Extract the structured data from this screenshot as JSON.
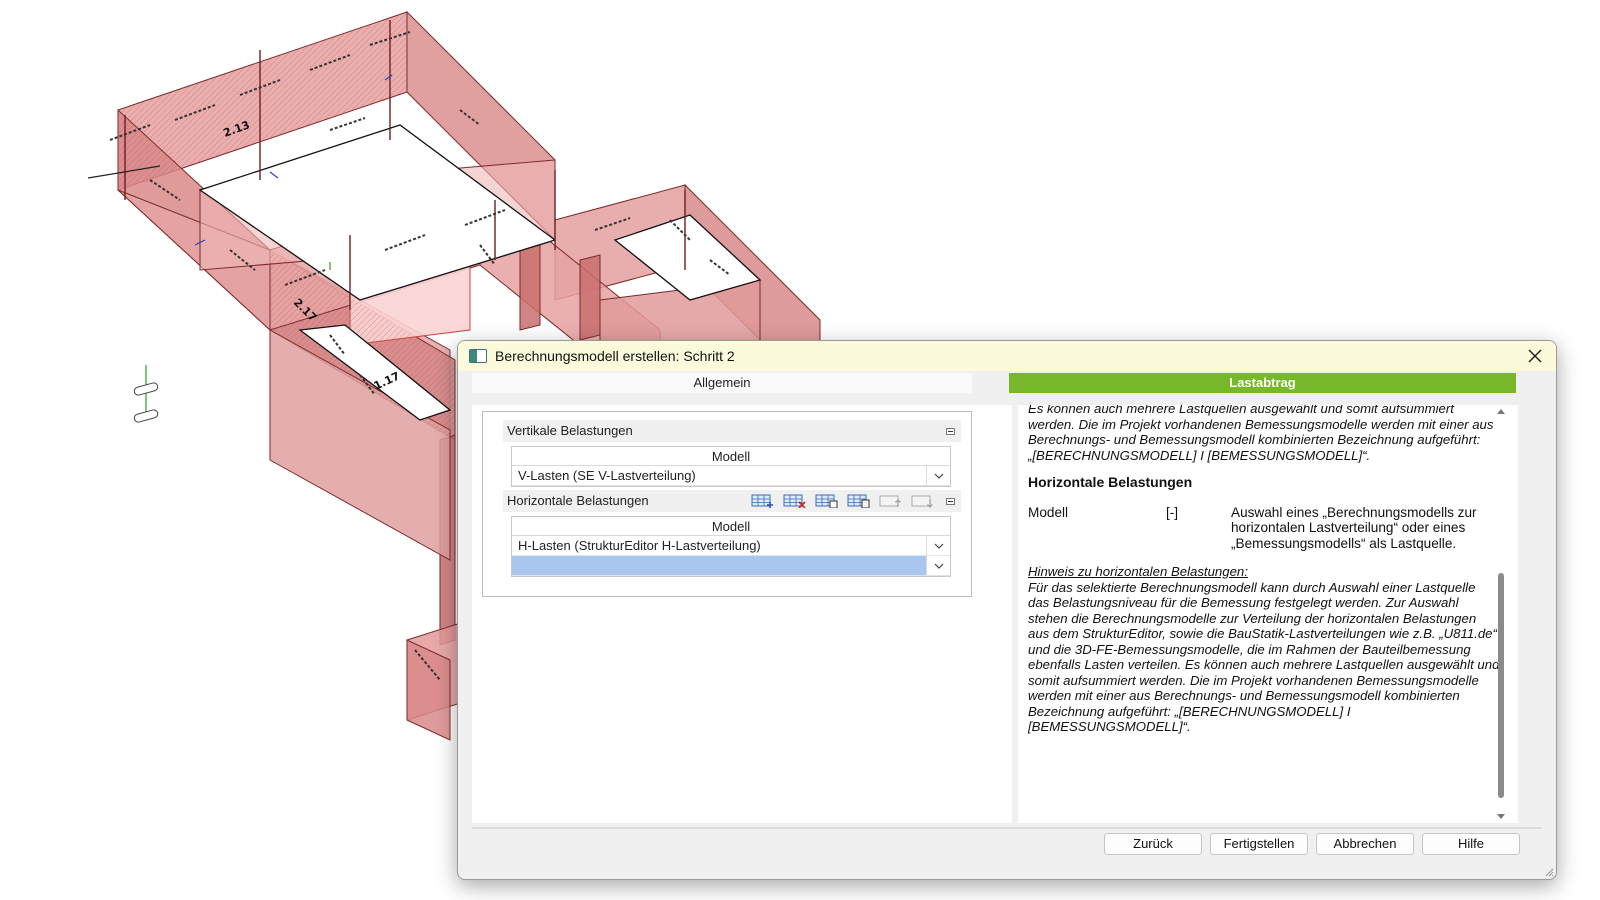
{
  "dialog": {
    "title": "Berechnungsmodell erstellen: Schritt 2",
    "tabs": [
      {
        "label": "Allgemein",
        "active": false
      },
      {
        "label": "Lastabtrag",
        "active": true
      }
    ],
    "accent_color": "#76b82a"
  },
  "vertical": {
    "section_label": "Vertikale Belastungen",
    "column_header": "Modell",
    "rows": [
      "V-Lasten (SE V-Lastverteilung)"
    ]
  },
  "horizontal": {
    "section_label": "Horizontale Belastungen",
    "column_header": "Modell",
    "rows": [
      "H-Lasten (StrukturEditor H-Lastverteilung)",
      ""
    ],
    "toolbar_icons": [
      "add-row-icon",
      "delete-row-icon",
      "copy-row-icon",
      "paste-row-icon",
      "move-up-icon",
      "move-down-icon"
    ]
  },
  "help": {
    "intro": "Es können auch mehrere Lastquellen ausgewählt und somit aufsummiert werden. Die im Projekt vorhandenen Bemessungsmodelle werden mit einer aus Berechnungs- und Bemessungsmodell kombinierten Bezeichnung aufgeführt: „[BERECHNUNGSMODELL] I [BEMESSUNGSMODELL]“.",
    "heading": "Horizontale Belastungen",
    "param_name": "Modell",
    "param_unit": "[-]",
    "param_desc": "Auswahl eines „Berechnungsmodells zur horizontalen Lastverteilung“ oder eines „Bemessungsmodells“ als Lastquelle.",
    "hint_title": "Hinweis zu horizontalen Belastungen:",
    "hint_text": "Für das selektierte Berechnungsmodell kann durch Auswahl einer Lastquelle das Belastungsniveau für die Bemessung festgelegt werden. Zur Auswahl stehen die Berechnungsmodelle zur Verteilung der horizontalen Belastungen aus dem StrukturEditor, sowie die BauStatik-Lastverteilungen wie z.B. „U811.de“ und die 3D-FE-Bemessungsmodelle, die im Rahmen der Bauteilbemessung ebenfalls Lasten verteilen. Es können auch mehrere Lastquellen ausgewählt und somit aufsummiert werden. Die im Projekt vorhandenen Bemessungsmodelle werden mit einer aus Berechnungs- und Bemessungsmodell kombinierten Bezeichnung aufgeführt: „[BERECHNUNGSMODELL] I [BEMESSUNGSMODELL]“."
  },
  "buttons": {
    "back": "Zurück",
    "finish": "Fertigstellen",
    "cancel": "Abbrechen",
    "help": "Hilfe"
  },
  "model_view": {
    "wall_color": "#e38a8a",
    "labels": [
      "2.13",
      "1.17",
      "2.17"
    ]
  }
}
